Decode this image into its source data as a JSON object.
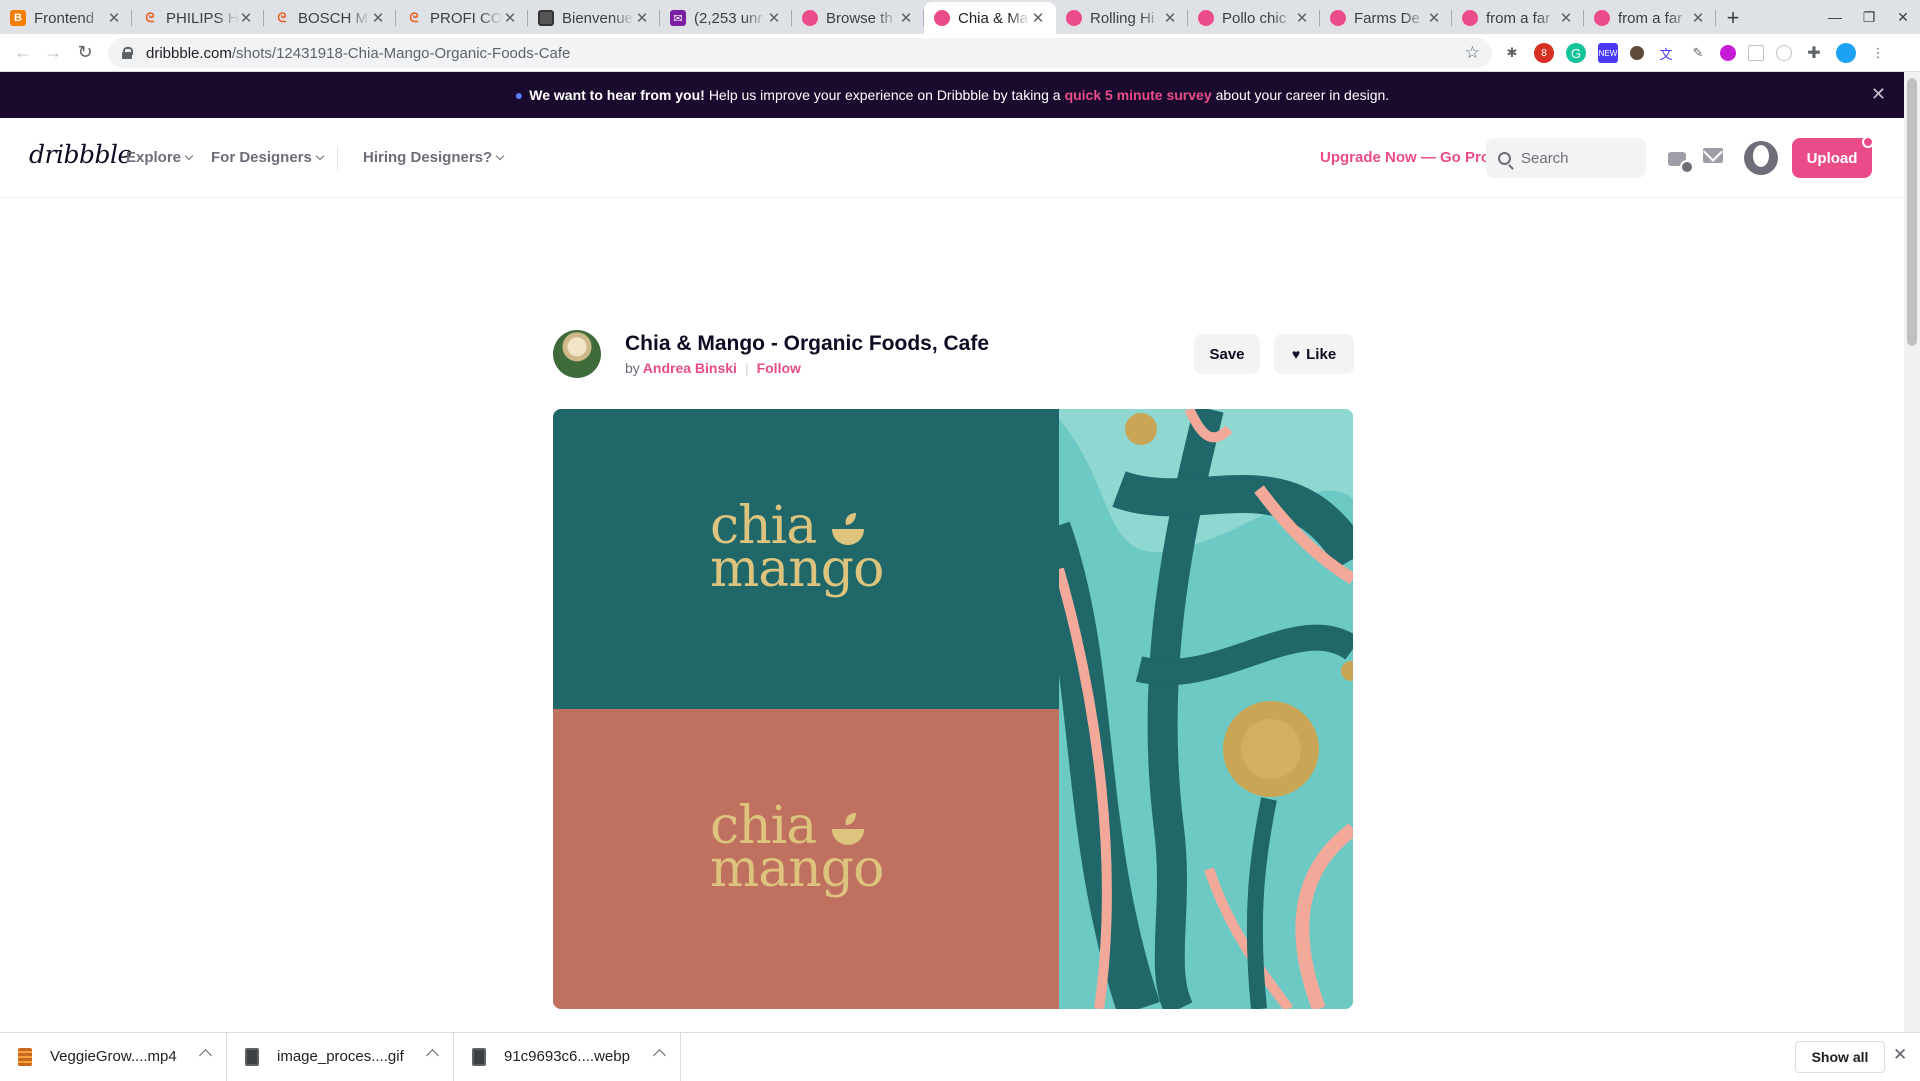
{
  "browser": {
    "tabs": [
      {
        "title": "Frontend",
        "favicon": "blogger-icon",
        "active": false
      },
      {
        "title": "PHILIPS H",
        "favicon": "aliexpress-icon",
        "active": false
      },
      {
        "title": "BOSCH M",
        "favicon": "aliexpress-icon",
        "active": false
      },
      {
        "title": "PROFI CO",
        "favicon": "aliexpress-icon",
        "active": false
      },
      {
        "title": "Bienvenue",
        "favicon": "bv-icon",
        "active": false
      },
      {
        "title": "(2,253 unr",
        "favicon": "mail-icon",
        "active": false
      },
      {
        "title": "Browse th",
        "favicon": "dribbble-icon",
        "active": false
      },
      {
        "title": "Chia & Ma",
        "favicon": "dribbble-icon",
        "active": true
      },
      {
        "title": "Rolling Hi",
        "favicon": "dribbble-icon",
        "active": false
      },
      {
        "title": "Pollo chic",
        "favicon": "dribbble-icon",
        "active": false
      },
      {
        "title": "Farms De",
        "favicon": "dribbble-icon",
        "active": false
      },
      {
        "title": "from a far",
        "favicon": "dribbble-icon",
        "active": false
      },
      {
        "title": "from a far",
        "favicon": "dribbble-icon",
        "active": false
      }
    ],
    "url_domain": "dribbble.com",
    "url_path": "/shots/12431918-Chia-Mango-Organic-Foods-Cafe"
  },
  "banner": {
    "bold": "We want to hear from you!",
    "text_before": "Help us improve your experience on Dribbble by taking a",
    "link": "quick 5 minute survey",
    "text_after": "about your career in design."
  },
  "header": {
    "logo": "dribbble",
    "nav": [
      "Explore",
      "For Designers",
      "Hiring Designers?"
    ],
    "go_pro": "Upgrade Now — Go Pro",
    "search_placeholder": "Search",
    "upload": "Upload"
  },
  "shot": {
    "title": "Chia & Mango - Organic Foods, Cafe",
    "by": "by",
    "author": "Andrea Binski",
    "follow": "Follow",
    "save": "Save",
    "like": "Like",
    "brand_line1": "chia",
    "brand_line2": "mango",
    "colors": {
      "teal": "#1f6769",
      "coral": "#bf705f",
      "gold": "#dcc37e",
      "aqua": "#6dc9c4",
      "pink": "#f2a99a"
    }
  },
  "downloads": {
    "items": [
      {
        "name": "VeggieGrow....mp4",
        "type": "video"
      },
      {
        "name": "image_proces....gif",
        "type": "image"
      },
      {
        "name": "91c9693c6....webp",
        "type": "image"
      }
    ],
    "show_all": "Show all"
  }
}
